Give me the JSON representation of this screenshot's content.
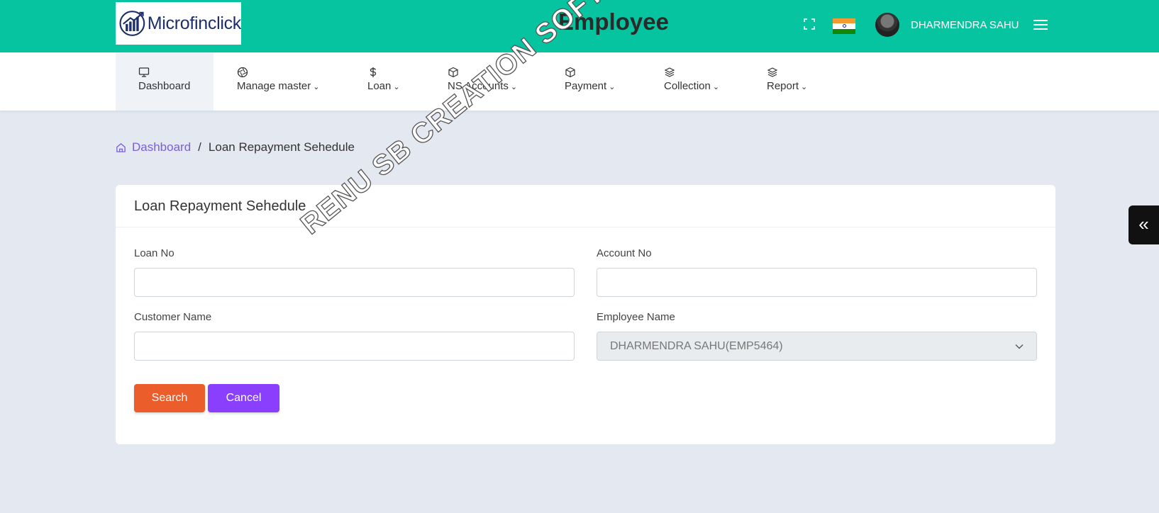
{
  "header": {
    "logo_text": "Microfinclick",
    "title": "Employee",
    "user_name": "DHARMENDRA SAHU",
    "brand_color": "#07c4a0"
  },
  "nav": {
    "items": [
      {
        "label": "Dashboard",
        "icon": "monitor-icon",
        "has_dropdown": false,
        "active": true
      },
      {
        "label": "Manage master",
        "icon": "aperture-icon",
        "has_dropdown": true
      },
      {
        "label": "Loan",
        "icon": "dollar-icon",
        "has_dropdown": true
      },
      {
        "label": "NS Accounts",
        "icon": "box-icon",
        "has_dropdown": true
      },
      {
        "label": "Payment",
        "icon": "box-icon",
        "has_dropdown": true
      },
      {
        "label": "Collection",
        "icon": "layers-icon",
        "has_dropdown": true
      },
      {
        "label": "Report",
        "icon": "layers-icon",
        "has_dropdown": true
      }
    ],
    "chevron": "⌄"
  },
  "breadcrumb": {
    "home": "Dashboard",
    "separator": "/",
    "current": "Loan Repayment Sehedule"
  },
  "form": {
    "title": "Loan Repayment Sehedule",
    "loan_no_label": "Loan No",
    "loan_no_value": "",
    "account_no_label": "Account No",
    "account_no_value": "",
    "customer_name_label": "Customer Name",
    "customer_name_value": "",
    "employee_name_label": "Employee Name",
    "employee_name_value": "DHARMENDRA SAHU(EMP5464)",
    "search_label": "Search",
    "cancel_label": "Cancel",
    "search_color": "#ec5d2c",
    "cancel_color": "#8a3ffc"
  },
  "side_toggle": "«",
  "watermark": "RENU SB CREATION SOFTWARE PVT. LTD."
}
